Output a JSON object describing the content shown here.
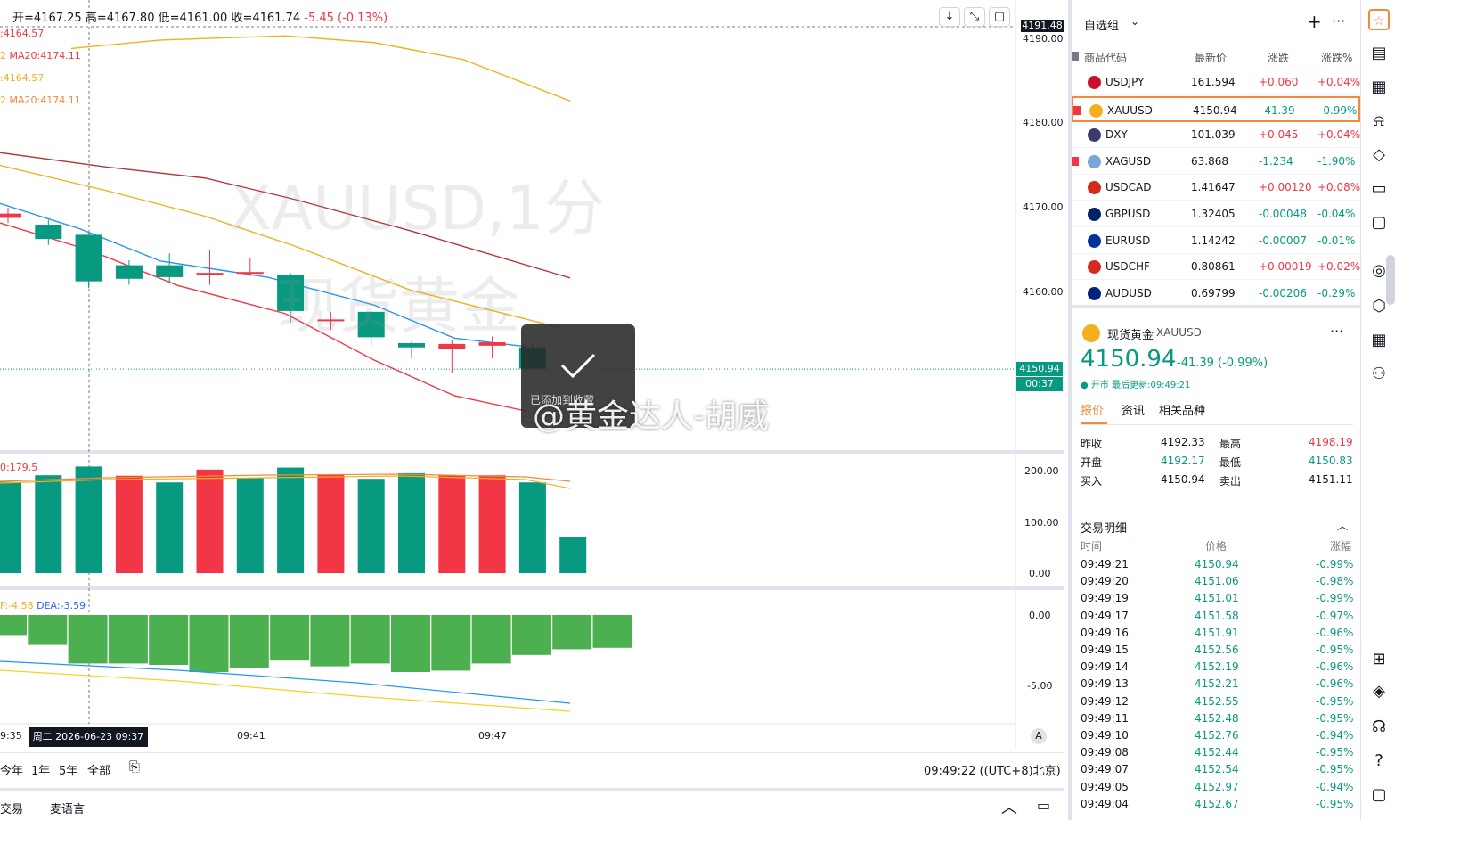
{
  "ohlc": {
    "open_label": "开=",
    "open": "4167.25",
    "high_label": "高=",
    "high": "4167.80",
    "low_label": "低=",
    "low": "4161.00",
    "close_label": "收=",
    "close": "4161.74",
    "change": "-5.45 (-0.13%)"
  },
  "ma_labels": [
    ":4164.57",
    "MA20:4174.11",
    ":4164.57",
    "MA20:4174.11"
  ],
  "ma_prefix": [
    "2",
    "2"
  ],
  "chart_controls": {
    "down": "↓",
    "collapse": "⤡",
    "settings": "▢"
  },
  "price_axis": {
    "labels": [
      "4191.48",
      "4190.00",
      "4180.00",
      "4170.00",
      "4160.00"
    ],
    "current_price": "4150.94",
    "countdown": "00:37",
    "volume_ticks": [
      "200.00",
      "100.00",
      "0.00"
    ],
    "macd_ticks": [
      "0.00",
      "-5.00"
    ]
  },
  "watermark": {
    "symbol": "XAUUSD,1分",
    "name": "现货黄金"
  },
  "volume_label": "0:179.5",
  "macd_labels": {
    "dif": "F:-4.58",
    "dea": "DEA:-3.59"
  },
  "time_axis": {
    "t1": "9:35",
    "crosshair": "周二 2026-06-23  09:37",
    "t2": "09:41",
    "t3": "09:47",
    "auto": "A"
  },
  "range_buttons": [
    "今年",
    "1年",
    "5年",
    "全部"
  ],
  "clock": "09:49:22 ((UTC+8)北京)",
  "bottom_tabs": [
    "交易",
    "麦语言"
  ],
  "toast": {
    "text": "已添加到收藏"
  },
  "weibo_mark": "@黄金达人-胡威",
  "watchlist": {
    "title": "自选组",
    "columns": [
      "商品代码",
      "最新价",
      "涨跌",
      "涨跌%"
    ],
    "rows": [
      {
        "symbol": "USDJPY",
        "price": "161.594",
        "change": "+0.060",
        "pct": "+0.04%",
        "dir": "up",
        "flag": "#c8102e"
      },
      {
        "symbol": "XAUUSD",
        "price": "4150.94",
        "change": "-41.39",
        "pct": "-0.99%",
        "dir": "down",
        "flag": "#f2b01e"
      },
      {
        "symbol": "DXY",
        "price": "101.039",
        "change": "+0.045",
        "pct": "+0.04%",
        "dir": "up",
        "flag": "#3c3b6e"
      },
      {
        "symbol": "XAGUSD",
        "price": "63.868",
        "change": "-1.234",
        "pct": "-1.90%",
        "dir": "down",
        "flag": "#7aa5d8"
      },
      {
        "symbol": "USDCAD",
        "price": "1.41647",
        "change": "+0.00120",
        "pct": "+0.08%",
        "dir": "up",
        "flag": "#d52b1e"
      },
      {
        "symbol": "GBPUSD",
        "price": "1.32405",
        "change": "-0.00048",
        "pct": "-0.04%",
        "dir": "down",
        "flag": "#012169"
      },
      {
        "symbol": "EURUSD",
        "price": "1.14242",
        "change": "-0.00007",
        "pct": "-0.01%",
        "dir": "down",
        "flag": "#003399"
      },
      {
        "symbol": "USDCHF",
        "price": "0.80861",
        "change": "+0.00019",
        "pct": "+0.02%",
        "dir": "up",
        "flag": "#d52b1e"
      },
      {
        "symbol": "AUDUSD",
        "price": "0.69799",
        "change": "-0.00206",
        "pct": "-0.29%",
        "dir": "down",
        "flag": "#00247d"
      }
    ]
  },
  "detail": {
    "name": "现货黄金",
    "symbol": "XAUUSD",
    "price_main": "4150.94",
    "change": "-41.39 (-0.99%)",
    "status": "● 开市 最后更新:09:49:21",
    "tabs": [
      "报价",
      "资讯",
      "相关品种"
    ],
    "stats": [
      {
        "k": "昨收",
        "v": "4192.33",
        "k2": "最高",
        "v2": "4198.19"
      },
      {
        "k": "开盘",
        "v": "4192.17",
        "k2": "最低",
        "v2": "4150.83"
      },
      {
        "k": "买入",
        "v": "4150.94",
        "k2": "卖出",
        "v2": "4151.11"
      }
    ]
  },
  "trades": {
    "title": "交易明细",
    "columns": [
      "时间",
      "价格",
      "涨幅"
    ],
    "rows": [
      [
        "09:49:21",
        "4150.94",
        "-0.99%"
      ],
      [
        "09:49:20",
        "4151.06",
        "-0.98%"
      ],
      [
        "09:49:19",
        "4151.01",
        "-0.99%"
      ],
      [
        "09:49:17",
        "4151.58",
        "-0.97%"
      ],
      [
        "09:49:16",
        "4151.91",
        "-0.96%"
      ],
      [
        "09:49:15",
        "4152.56",
        "-0.95%"
      ],
      [
        "09:49:14",
        "4152.19",
        "-0.96%"
      ],
      [
        "09:49:13",
        "4152.21",
        "-0.96%"
      ],
      [
        "09:49:12",
        "4152.55",
        "-0.95%"
      ],
      [
        "09:49:11",
        "4152.48",
        "-0.95%"
      ],
      [
        "09:49:10",
        "4152.76",
        "-0.94%"
      ],
      [
        "09:49:08",
        "4152.44",
        "-0.95%"
      ],
      [
        "09:49:07",
        "4152.54",
        "-0.95%"
      ],
      [
        "09:49:05",
        "4152.97",
        "-0.94%"
      ],
      [
        "09:49:04",
        "4152.67",
        "-0.95%"
      ]
    ]
  },
  "candles": [
    {
      "o": 4168.8,
      "c": 4169.3,
      "h": 4170.0,
      "l": 4168.2
    },
    {
      "o": 4168.0,
      "c": 4166.3,
      "h": 4168.6,
      "l": 4165.6
    },
    {
      "o": 4166.8,
      "c": 4161.3,
      "h": 4167.0,
      "l": 4160.5
    },
    {
      "o": 4163.2,
      "c": 4161.6,
      "h": 4163.8,
      "l": 4160.9
    },
    {
      "o": 4163.2,
      "c": 4161.8,
      "h": 4164.6,
      "l": 4161.2
    },
    {
      "o": 4162.0,
      "c": 4162.3,
      "h": 4165.0,
      "l": 4160.9
    },
    {
      "o": 4162.2,
      "c": 4162.4,
      "h": 4164.1,
      "l": 4161.9
    },
    {
      "o": 4162.0,
      "c": 4157.8,
      "h": 4162.3,
      "l": 4156.4
    },
    {
      "o": 4156.6,
      "c": 4156.8,
      "h": 4157.7,
      "l": 4155.6
    },
    {
      "o": 4157.7,
      "c": 4154.7,
      "h": 4157.9,
      "l": 4153.7
    },
    {
      "o": 4154.0,
      "c": 4153.5,
      "h": 4154.2,
      "l": 4152.2
    },
    {
      "o": 4153.3,
      "c": 4153.9,
      "h": 4154.4,
      "l": 4150.5
    },
    {
      "o": 4153.7,
      "c": 4154.1,
      "h": 4154.8,
      "l": 4152.2
    },
    {
      "o": 4153.5,
      "c": 4151.0,
      "h": 4153.9,
      "l": 4150.8
    }
  ],
  "volumes": [
    {
      "v": 178,
      "dir": "down"
    },
    {
      "v": 191,
      "dir": "down"
    },
    {
      "v": 208,
      "dir": "down"
    },
    {
      "v": 190,
      "dir": "up"
    },
    {
      "v": 177,
      "dir": "down"
    },
    {
      "v": 202,
      "dir": "up"
    },
    {
      "v": 186,
      "dir": "down"
    },
    {
      "v": 206,
      "dir": "down"
    },
    {
      "v": 193,
      "dir": "up"
    },
    {
      "v": 184,
      "dir": "down"
    },
    {
      "v": 195,
      "dir": "down"
    },
    {
      "v": 191,
      "dir": "up"
    },
    {
      "v": 191,
      "dir": "up"
    },
    {
      "v": 177,
      "dir": "down"
    },
    {
      "v": 70,
      "dir": "down"
    }
  ],
  "macd_hist": [
    -1.4,
    -2.1,
    -3.4,
    -3.4,
    -3.5,
    -4.0,
    -3.7,
    -3.2,
    -3.6,
    -3.4,
    -4.0,
    -3.9,
    -3.4,
    -2.8,
    -2.4,
    -2.3
  ],
  "colors": {
    "up": "#f23645",
    "down": "#089981",
    "accent": "#f5883b",
    "gold": "#f2b01e"
  }
}
